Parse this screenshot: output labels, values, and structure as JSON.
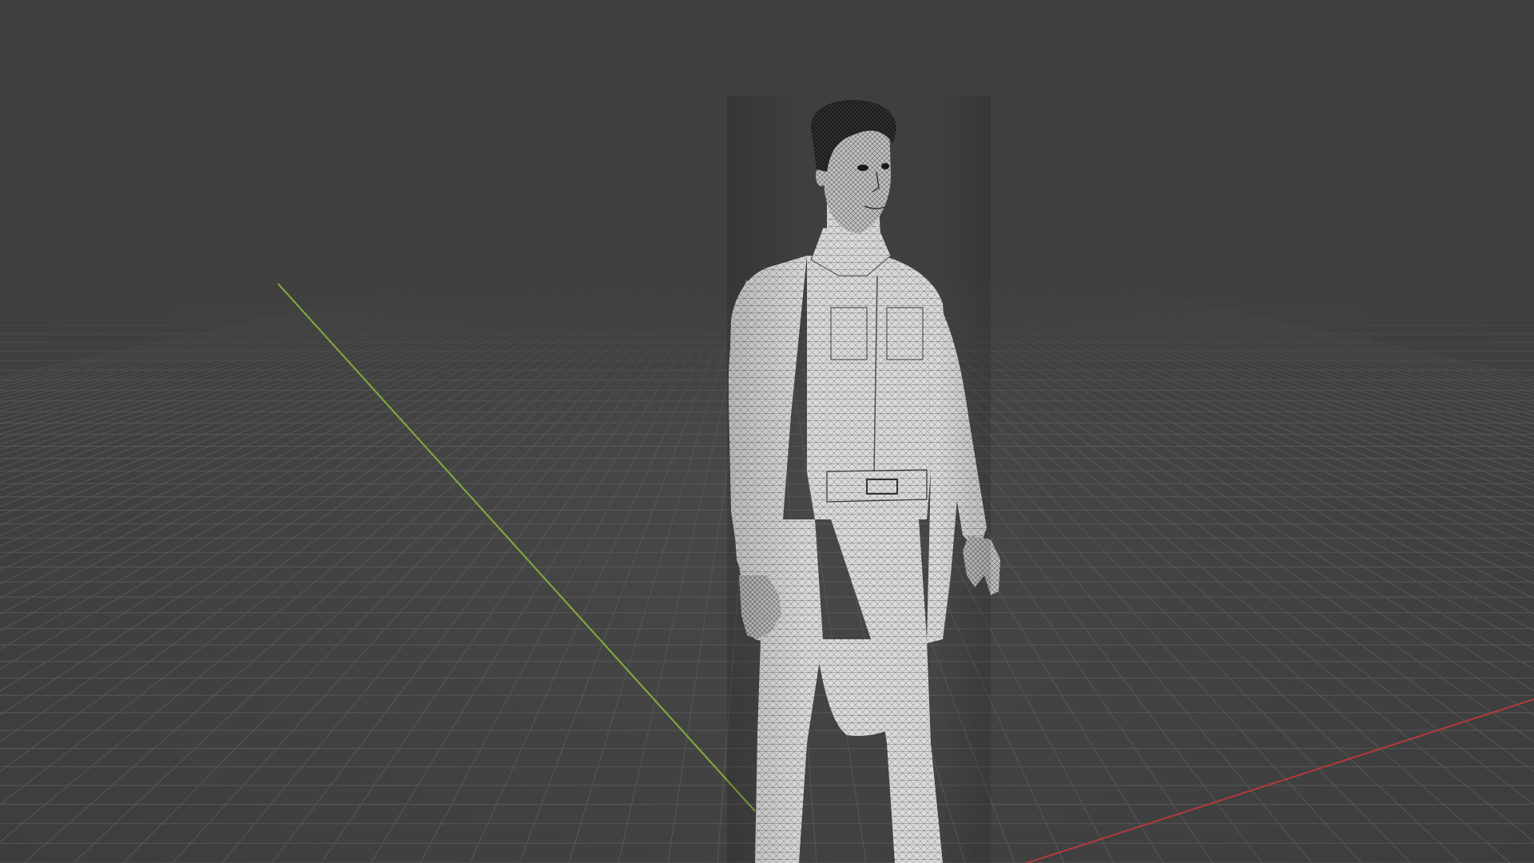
{
  "scene": {
    "background_color": "#3f3f3f",
    "grid_color": "#5a5a5a",
    "x_axis_color": "#c0393c",
    "y_axis_color": "#8bb53a",
    "model_color": "#d9d9d9",
    "wire_color": "#2a2a2a",
    "hair_color": "#1e1e1e"
  }
}
